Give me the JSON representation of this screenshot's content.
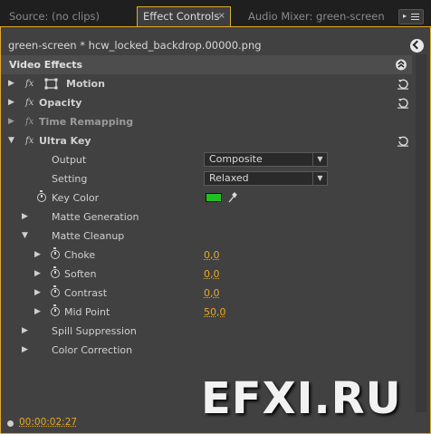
{
  "tabs": {
    "source": "Source: (no clips)",
    "effect_controls": "Effect Controls",
    "audio_mixer": "Audio Mixer: green-screen",
    "close_glyph": "×"
  },
  "clip": {
    "title": "green-screen * hcw_locked_backdrop.00000.png"
  },
  "video_effects": {
    "header": "Video Effects"
  },
  "effects": {
    "motion": {
      "label": "Motion",
      "fx": "fx"
    },
    "opacity": {
      "label": "Opacity",
      "fx": "fx"
    },
    "time_remapping": {
      "label": "Time Remapping",
      "fx": "fx"
    },
    "ultra_key": {
      "label": "Ultra Key",
      "fx": "fx",
      "output": {
        "label": "Output",
        "value": "Composite"
      },
      "setting": {
        "label": "Setting",
        "value": "Relaxed"
      },
      "key_color": {
        "label": "Key Color",
        "color": "#20c020"
      },
      "matte_generation": {
        "label": "Matte Generation"
      },
      "matte_cleanup": {
        "label": "Matte Cleanup",
        "choke": {
          "label": "Choke",
          "value": "0,0"
        },
        "soften": {
          "label": "Soften",
          "value": "0,0"
        },
        "contrast": {
          "label": "Contrast",
          "value": "0,0"
        },
        "mid_point": {
          "label": "Mid Point",
          "value": "50,0"
        }
      },
      "spill_suppression": {
        "label": "Spill Suppression"
      },
      "color_correction": {
        "label": "Color Correction"
      }
    }
  },
  "footer": {
    "timecode": "00:00:02:27"
  },
  "watermark": "EFXI.RU",
  "colors": {
    "accent": "#e2a92a",
    "value": "#e9a820",
    "panel": "#414141"
  },
  "icons": [
    "panel-menu-icon",
    "show-clip-icon",
    "collapse-all-icon",
    "reset-icon",
    "stopwatch-icon",
    "eyedropper-icon",
    "disclosure-triangle-icon",
    "motion-transform-icon"
  ]
}
